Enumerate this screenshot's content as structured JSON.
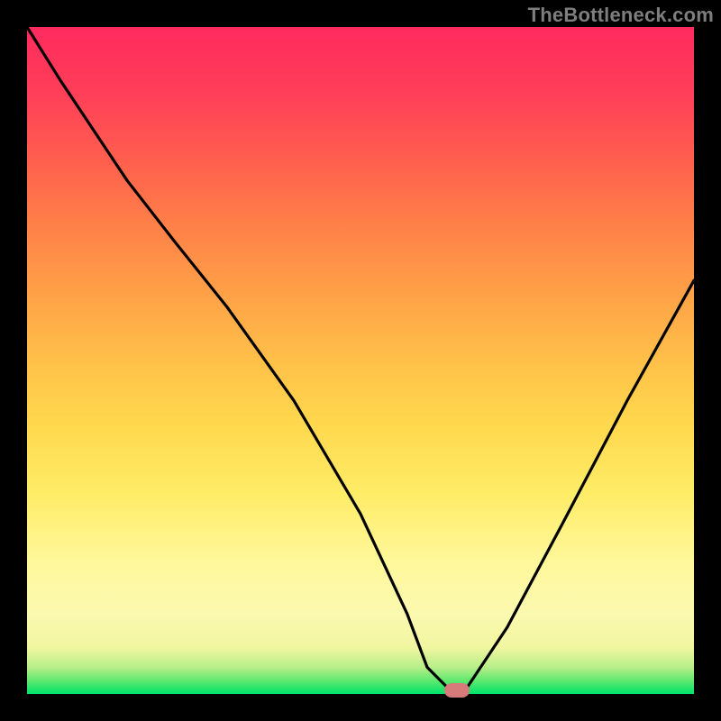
{
  "watermark": "TheBottleneck.com",
  "colors": {
    "frame": "#000000",
    "curve": "#000000",
    "marker": "#d77a7a",
    "gradient_top": "#ff2a5e",
    "gradient_bottom": "#00e36a"
  },
  "chart_data": {
    "type": "line",
    "title": "",
    "xlabel": "",
    "ylabel": "",
    "xlim": [
      0,
      100
    ],
    "ylim": [
      0,
      100
    ],
    "grid": false,
    "legend": false,
    "series": [
      {
        "name": "bottleneck-curve",
        "x": [
          0,
          5,
          15,
          22,
          30,
          40,
          50,
          57,
          60,
          63,
          66,
          72,
          80,
          90,
          100
        ],
        "values": [
          100,
          92,
          77,
          68,
          58,
          44,
          27,
          12,
          4,
          1,
          1,
          10,
          25,
          44,
          62
        ]
      }
    ],
    "marker": {
      "x": 64.5,
      "y": 0.5
    }
  }
}
